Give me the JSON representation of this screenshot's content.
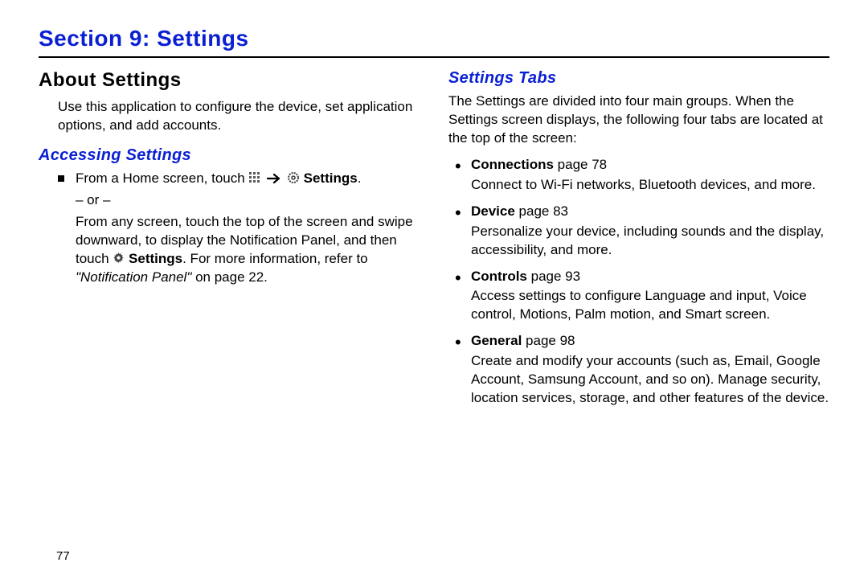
{
  "section_title": "Section 9: Settings",
  "page_number": "77",
  "left": {
    "heading": "About Settings",
    "intro": "Use this application to configure the device, set application options, and add accounts.",
    "accessing_heading": "Accessing Settings",
    "line_prefix": "From a Home screen, touch ",
    "settings_word": "Settings",
    "period": ".",
    "or_text": "– or –",
    "para2_a": "From any screen, touch the top of the screen and swipe downward, to display the Notification Panel, and then touch ",
    "para2_b": "Settings",
    "para2_c": ". For more information, refer to ",
    "ref_text": "\"Notification Panel\"",
    "ref_tail": " on page 22."
  },
  "right": {
    "tabs_heading": "Settings Tabs",
    "intro": "The Settings are divided into four main groups. When the Settings screen displays, the following four tabs are located at the top of the screen:",
    "items": [
      {
        "label": "Connections",
        "page": " page 78",
        "desc": "Connect to Wi-Fi networks, Bluetooth devices, and more."
      },
      {
        "label": "Device",
        "page": " page 83",
        "desc": "Personalize your device, including sounds and the display, accessibility, and more."
      },
      {
        "label": "Controls",
        "page": " page 93",
        "desc": "Access settings to configure Language and input, Voice control, Motions, Palm motion, and Smart screen."
      },
      {
        "label": "General",
        "page": " page 98",
        "desc": "Create and modify your accounts (such as, Email, Google Account, Samsung Account, and so on). Manage security, location services, storage, and other features of the device."
      }
    ]
  }
}
